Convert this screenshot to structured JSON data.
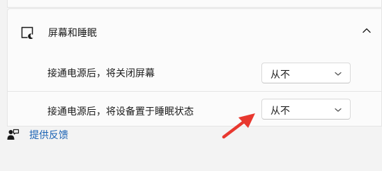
{
  "section": {
    "title": "屏幕和睡眠",
    "icon": "display-sleep-icon",
    "collapse_icon": "chevron-up-icon"
  },
  "rows": [
    {
      "label": "接通电源后，将关闭屏幕",
      "value": "从不",
      "icon": "chevron-down-icon"
    },
    {
      "label": "接通电源后，将设备置于睡眠状态",
      "value": "从不",
      "icon": "chevron-down-icon"
    }
  ],
  "feedback": {
    "label": "提供反馈",
    "icon": "feedback-person-icon"
  },
  "annotation": {
    "icon": "red-arrow-icon",
    "color": "#e8382f"
  },
  "colors": {
    "link": "#1a62b4",
    "card": "#fbfbfb",
    "background": "#f3f3f3"
  }
}
